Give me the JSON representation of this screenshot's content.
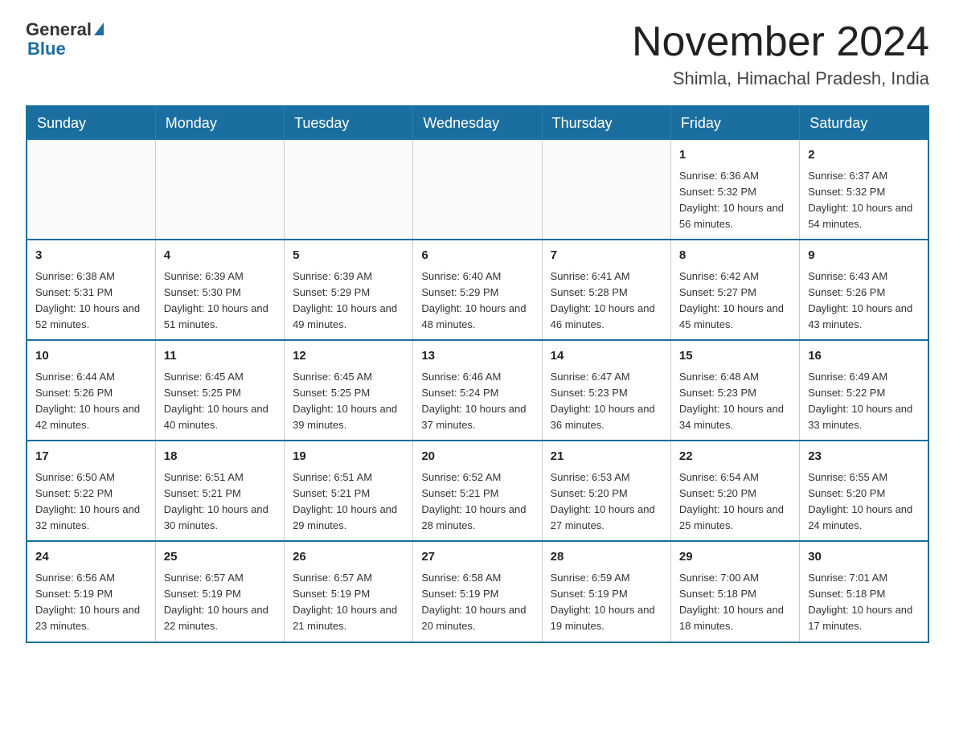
{
  "logo": {
    "general": "General",
    "blue": "Blue"
  },
  "title": "November 2024",
  "subtitle": "Shimla, Himachal Pradesh, India",
  "days_of_week": [
    "Sunday",
    "Monday",
    "Tuesday",
    "Wednesday",
    "Thursday",
    "Friday",
    "Saturday"
  ],
  "weeks": [
    [
      {
        "day": "",
        "info": ""
      },
      {
        "day": "",
        "info": ""
      },
      {
        "day": "",
        "info": ""
      },
      {
        "day": "",
        "info": ""
      },
      {
        "day": "",
        "info": ""
      },
      {
        "day": "1",
        "info": "Sunrise: 6:36 AM\nSunset: 5:32 PM\nDaylight: 10 hours and 56 minutes."
      },
      {
        "day": "2",
        "info": "Sunrise: 6:37 AM\nSunset: 5:32 PM\nDaylight: 10 hours and 54 minutes."
      }
    ],
    [
      {
        "day": "3",
        "info": "Sunrise: 6:38 AM\nSunset: 5:31 PM\nDaylight: 10 hours and 52 minutes."
      },
      {
        "day": "4",
        "info": "Sunrise: 6:39 AM\nSunset: 5:30 PM\nDaylight: 10 hours and 51 minutes."
      },
      {
        "day": "5",
        "info": "Sunrise: 6:39 AM\nSunset: 5:29 PM\nDaylight: 10 hours and 49 minutes."
      },
      {
        "day": "6",
        "info": "Sunrise: 6:40 AM\nSunset: 5:29 PM\nDaylight: 10 hours and 48 minutes."
      },
      {
        "day": "7",
        "info": "Sunrise: 6:41 AM\nSunset: 5:28 PM\nDaylight: 10 hours and 46 minutes."
      },
      {
        "day": "8",
        "info": "Sunrise: 6:42 AM\nSunset: 5:27 PM\nDaylight: 10 hours and 45 minutes."
      },
      {
        "day": "9",
        "info": "Sunrise: 6:43 AM\nSunset: 5:26 PM\nDaylight: 10 hours and 43 minutes."
      }
    ],
    [
      {
        "day": "10",
        "info": "Sunrise: 6:44 AM\nSunset: 5:26 PM\nDaylight: 10 hours and 42 minutes."
      },
      {
        "day": "11",
        "info": "Sunrise: 6:45 AM\nSunset: 5:25 PM\nDaylight: 10 hours and 40 minutes."
      },
      {
        "day": "12",
        "info": "Sunrise: 6:45 AM\nSunset: 5:25 PM\nDaylight: 10 hours and 39 minutes."
      },
      {
        "day": "13",
        "info": "Sunrise: 6:46 AM\nSunset: 5:24 PM\nDaylight: 10 hours and 37 minutes."
      },
      {
        "day": "14",
        "info": "Sunrise: 6:47 AM\nSunset: 5:23 PM\nDaylight: 10 hours and 36 minutes."
      },
      {
        "day": "15",
        "info": "Sunrise: 6:48 AM\nSunset: 5:23 PM\nDaylight: 10 hours and 34 minutes."
      },
      {
        "day": "16",
        "info": "Sunrise: 6:49 AM\nSunset: 5:22 PM\nDaylight: 10 hours and 33 minutes."
      }
    ],
    [
      {
        "day": "17",
        "info": "Sunrise: 6:50 AM\nSunset: 5:22 PM\nDaylight: 10 hours and 32 minutes."
      },
      {
        "day": "18",
        "info": "Sunrise: 6:51 AM\nSunset: 5:21 PM\nDaylight: 10 hours and 30 minutes."
      },
      {
        "day": "19",
        "info": "Sunrise: 6:51 AM\nSunset: 5:21 PM\nDaylight: 10 hours and 29 minutes."
      },
      {
        "day": "20",
        "info": "Sunrise: 6:52 AM\nSunset: 5:21 PM\nDaylight: 10 hours and 28 minutes."
      },
      {
        "day": "21",
        "info": "Sunrise: 6:53 AM\nSunset: 5:20 PM\nDaylight: 10 hours and 27 minutes."
      },
      {
        "day": "22",
        "info": "Sunrise: 6:54 AM\nSunset: 5:20 PM\nDaylight: 10 hours and 25 minutes."
      },
      {
        "day": "23",
        "info": "Sunrise: 6:55 AM\nSunset: 5:20 PM\nDaylight: 10 hours and 24 minutes."
      }
    ],
    [
      {
        "day": "24",
        "info": "Sunrise: 6:56 AM\nSunset: 5:19 PM\nDaylight: 10 hours and 23 minutes."
      },
      {
        "day": "25",
        "info": "Sunrise: 6:57 AM\nSunset: 5:19 PM\nDaylight: 10 hours and 22 minutes."
      },
      {
        "day": "26",
        "info": "Sunrise: 6:57 AM\nSunset: 5:19 PM\nDaylight: 10 hours and 21 minutes."
      },
      {
        "day": "27",
        "info": "Sunrise: 6:58 AM\nSunset: 5:19 PM\nDaylight: 10 hours and 20 minutes."
      },
      {
        "day": "28",
        "info": "Sunrise: 6:59 AM\nSunset: 5:19 PM\nDaylight: 10 hours and 19 minutes."
      },
      {
        "day": "29",
        "info": "Sunrise: 7:00 AM\nSunset: 5:18 PM\nDaylight: 10 hours and 18 minutes."
      },
      {
        "day": "30",
        "info": "Sunrise: 7:01 AM\nSunset: 5:18 PM\nDaylight: 10 hours and 17 minutes."
      }
    ]
  ]
}
